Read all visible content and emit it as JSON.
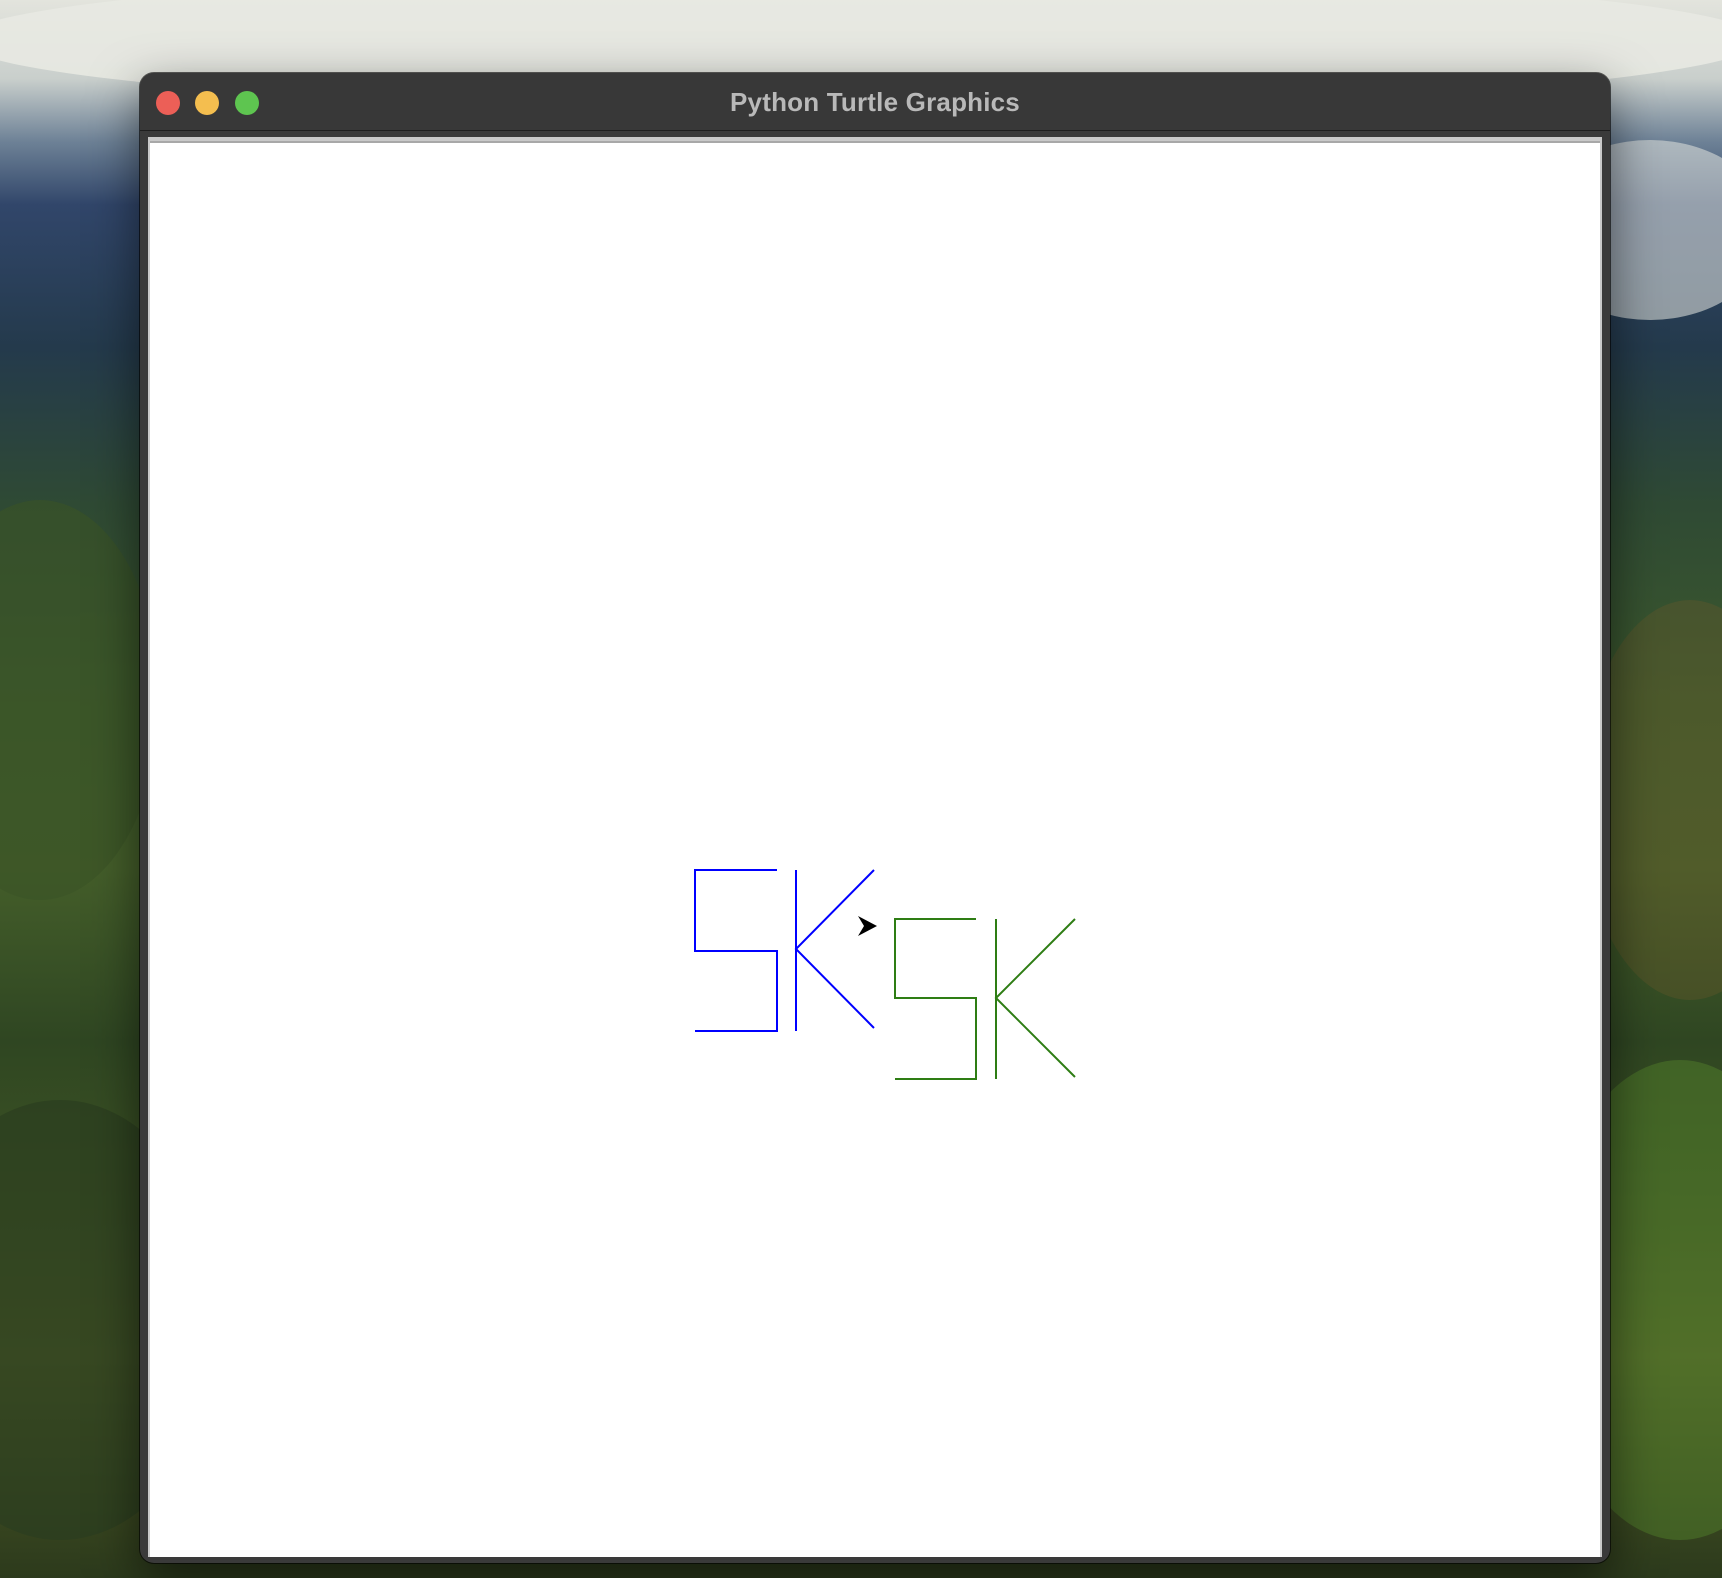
{
  "window": {
    "title": "Python Turtle Graphics",
    "buttons": {
      "close": "close-button",
      "minimize": "minimize-button",
      "zoom": "zoom-button"
    }
  },
  "canvas": {
    "drawings": [
      {
        "text": "5K",
        "color": "#0000ff"
      },
      {
        "text": "5K",
        "color": "#2e7d14"
      }
    ],
    "turtle": {
      "shape": "arrow",
      "color": "#000000",
      "heading": "east"
    }
  },
  "colors": {
    "titlebar": "#383838",
    "title_text": "#b9b9b9",
    "close": "#ec5f57",
    "minimize": "#f4be4f",
    "zoom": "#5ec550"
  }
}
